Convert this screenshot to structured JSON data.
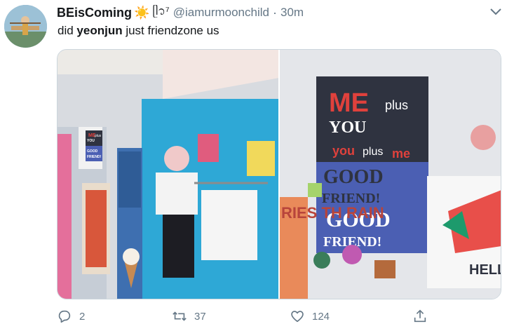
{
  "tweet": {
    "display_name": "BEisComing",
    "sun_emoji": "☀️",
    "idol_glyph": "ᥫ᭡⁷",
    "handle": "@iamurmoonchild",
    "separator": "·",
    "time": "30m",
    "text_before": "did ",
    "text_bold": "yeonjun",
    "text_after": " just friendzone us"
  },
  "media": {
    "left_poster": {
      "line1": "ME",
      "line2": "plus",
      "line3": "YOU",
      "line4": "GOOD",
      "line5": "FRIEND!"
    },
    "right_poster": {
      "me": "ME",
      "plus1": "plus",
      "you": "YOU",
      "you2": "you",
      "plus2": "plus",
      "me2": "me",
      "good1": "GOOD",
      "friend1": "FRIEND!",
      "good2": "GOOD",
      "friend2": "FRIEND!",
      "side_text": "RIES TH RAIN",
      "hello": "HELLO"
    }
  },
  "actions": {
    "reply_count": "2",
    "retweet_count": "37",
    "like_count": "124"
  },
  "colors": {
    "accent": "#1da1f2",
    "muted": "#657786",
    "wall_blue": "#2ea8d6",
    "poster_dark": "#2f3340",
    "poster_purple": "#4b5fb3",
    "poster_red": "#e0413c"
  },
  "icons": [
    "avatar-image",
    "chevron-down-icon",
    "reply-icon",
    "retweet-icon",
    "like-icon",
    "share-icon"
  ]
}
